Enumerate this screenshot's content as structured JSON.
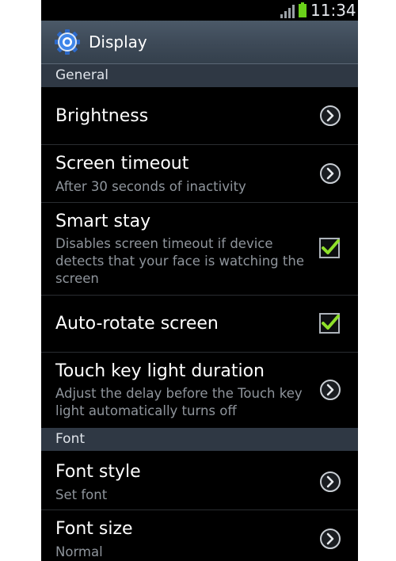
{
  "status_bar": {
    "time": "11:34",
    "signal_icon": "signal-icon",
    "battery_icon": "battery-icon",
    "battery_color": "#6bd11a"
  },
  "title_bar": {
    "title": "Display",
    "icon": "settings-gear-icon"
  },
  "sections": {
    "general": "General",
    "font": "Font"
  },
  "items": {
    "brightness": {
      "title": "Brightness"
    },
    "screen_timeout": {
      "title": "Screen timeout",
      "summary": "After 30 seconds of inactivity"
    },
    "smart_stay": {
      "title": "Smart stay",
      "summary": "Disables screen timeout if device detects that your face is watching the screen",
      "checked": true
    },
    "auto_rotate": {
      "title": "Auto-rotate screen",
      "checked": true
    },
    "touch_key": {
      "title": "Touch key light duration",
      "summary": "Adjust the delay before the Touch key light automatically turns off"
    },
    "font_style": {
      "title": "Font style",
      "summary": "Set font"
    },
    "font_size": {
      "title": "Font size",
      "summary": "Normal"
    }
  },
  "colors": {
    "check_green": "#8ee02a",
    "header_bg": "#2f3844",
    "secondary_text": "#8f959c"
  }
}
